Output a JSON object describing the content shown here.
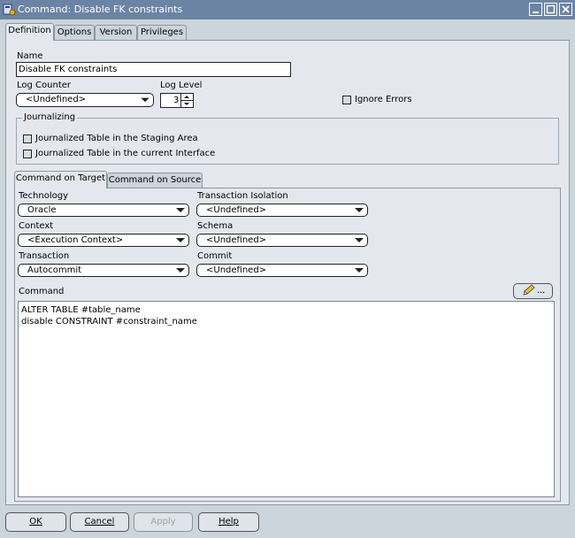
{
  "window": {
    "title": "Command: Disable FK constraints"
  },
  "tabs": [
    {
      "label": "Definition",
      "active": true
    },
    {
      "label": "Options",
      "active": false
    },
    {
      "label": "Version",
      "active": false
    },
    {
      "label": "Privileges",
      "active": false
    }
  ],
  "definition": {
    "name_label": "Name",
    "name_value": "Disable FK constraints",
    "log_counter_label": "Log Counter",
    "log_counter_value": "<Undefined>",
    "log_level_label": "Log Level",
    "log_level_value": "3",
    "ignore_errors_label": "Ignore Errors",
    "journalizing": {
      "label": "Journalizing",
      "staging_label": "Journalized Table in the Staging Area",
      "interface_label": "Journalized Table in the current Interface"
    }
  },
  "subtabs": [
    {
      "label": "Command on Target",
      "active": true
    },
    {
      "label": "Command on Source",
      "active": false
    }
  ],
  "target": {
    "technology_label": "Technology",
    "technology_value": "Oracle",
    "isolation_label": "Transaction Isolation",
    "isolation_value": "<Undefined>",
    "context_label": "Context",
    "context_value": "<Execution Context>",
    "schema_label": "Schema",
    "schema_value": "<Undefined>",
    "transaction_label": "Transaction",
    "transaction_value": "Autocommit",
    "commit_label": "Commit",
    "commit_value": "<Undefined>",
    "command_label": "Command",
    "edit_button_label": "...",
    "command_line1": "ALTER TABLE #table_name",
    "command_line2": "disable CONSTRAINT #constraint_name"
  },
  "buttons": {
    "ok": "OK",
    "cancel": "Cancel",
    "apply": "Apply",
    "help": "Help"
  },
  "colors": {
    "titlebar": "#6c84a4",
    "background": "#ccd4dc",
    "panel": "#e4e8ee"
  }
}
